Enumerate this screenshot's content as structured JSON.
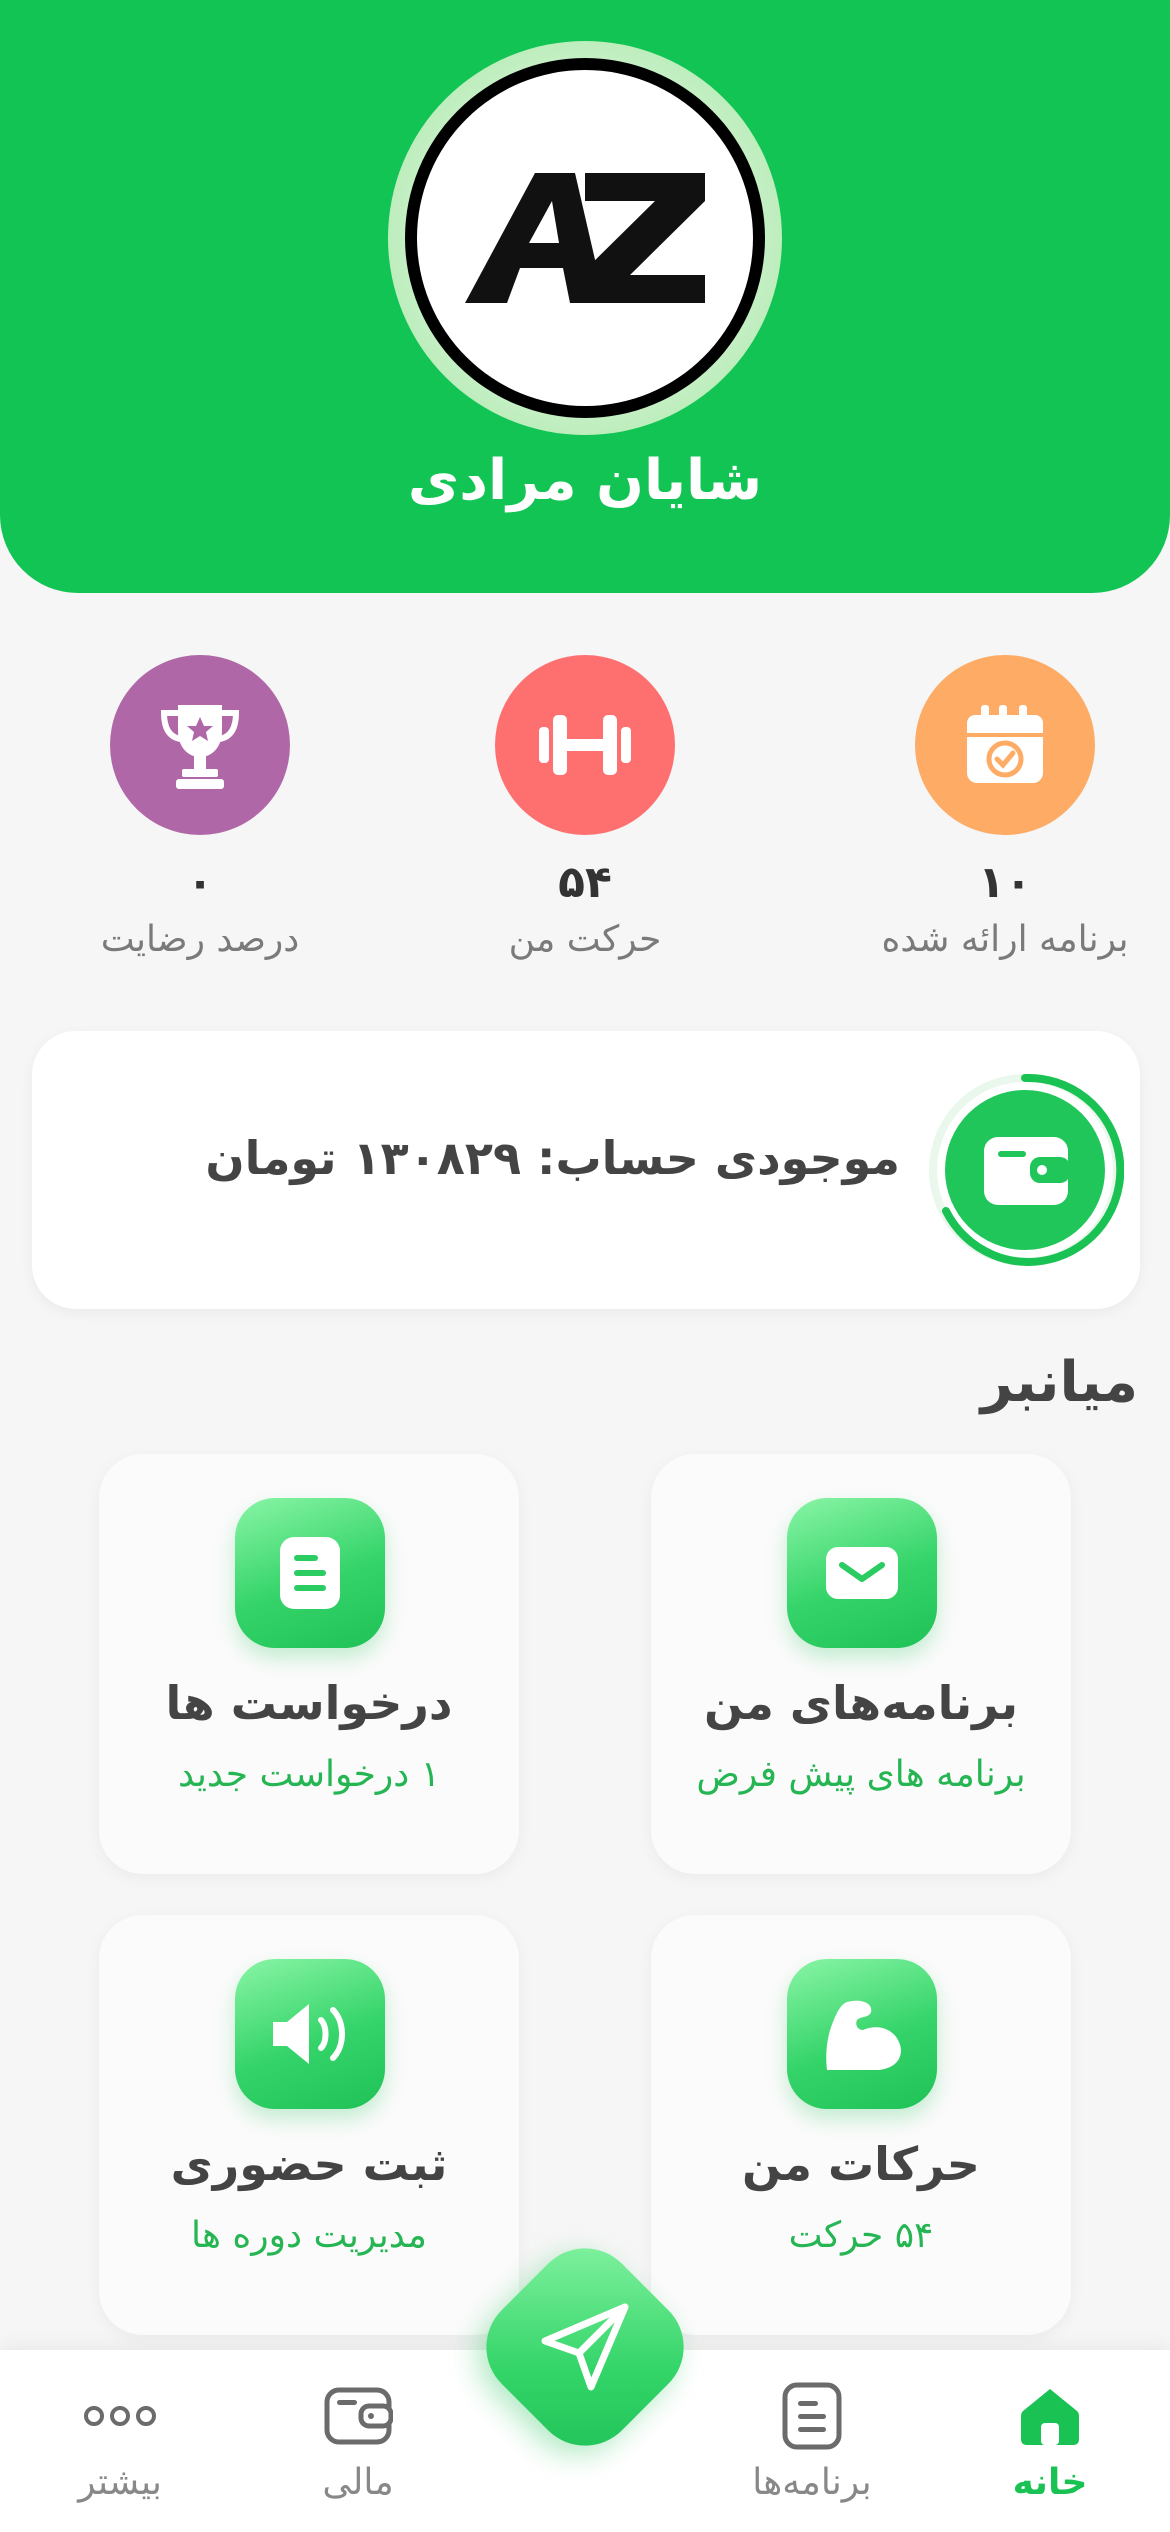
{
  "profile": {
    "logo_text": "AZ",
    "name": "شایان مرادی"
  },
  "stats": [
    {
      "value": "۱۰",
      "label": "برنامه ارائه شده",
      "icon": "calendar-check-icon",
      "color": "#fdab65"
    },
    {
      "value": "۵۴",
      "label": "حرکت من",
      "icon": "dumbbell-icon",
      "color": "#fe7070"
    },
    {
      "value": "۰",
      "label": "درصد رضایت",
      "icon": "trophy-icon",
      "color": "#b067a8"
    }
  ],
  "balance": {
    "text": "موجودی حساب: ۱۳۰۸۲۹ تومان",
    "icon": "wallet-icon"
  },
  "shortcuts": {
    "title": "میانبر",
    "items": [
      {
        "title": "برنامه‌های من",
        "subtitle": "برنامه های پیش فرض",
        "icon": "mail-icon"
      },
      {
        "title": "درخواست ها",
        "subtitle": "۱ درخواست جدید",
        "icon": "document-icon"
      },
      {
        "title": "حرکات من",
        "subtitle": "۵۴ حرکت",
        "icon": "arm-muscle-icon"
      },
      {
        "title": "ثبت حضوری",
        "subtitle": "مدیریت دوره ها",
        "icon": "speaker-icon"
      }
    ]
  },
  "nav": {
    "items": [
      {
        "label": "خانه",
        "icon": "home-icon",
        "active": true
      },
      {
        "label": "برنامه‌ها",
        "icon": "document-icon",
        "active": false
      },
      {
        "label": "مالی",
        "icon": "wallet-icon",
        "active": false
      },
      {
        "label": "بیشتر",
        "icon": "more-dots-icon",
        "active": false
      }
    ],
    "fab_icon": "send-icon"
  },
  "colors": {
    "brand_green": "#12c453",
    "accent_green": "#26b553"
  }
}
